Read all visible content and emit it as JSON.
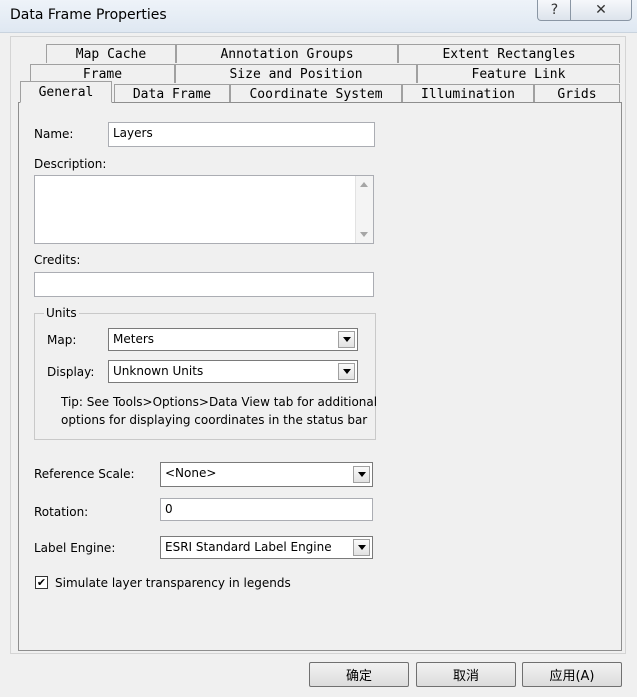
{
  "window": {
    "title": "Data Frame Properties",
    "help_glyph": "?",
    "close_glyph": "✕"
  },
  "tabs": {
    "row1": [
      "Map Cache",
      "Annotation Groups",
      "Extent Rectangles"
    ],
    "row2": [
      "Frame",
      "Size and Position",
      "Feature Link"
    ],
    "row3": [
      "General",
      "Data Frame",
      "Coordinate System",
      "Illumination",
      "Grids"
    ],
    "active": "General"
  },
  "general": {
    "name_label": "Name:",
    "name_value": "Layers",
    "description_label": "Description:",
    "description_value": "",
    "credits_label": "Credits:",
    "credits_value": "",
    "units": {
      "group_label": "Units",
      "map_label": "Map:",
      "map_value": "Meters",
      "display_label": "Display:",
      "display_value": "Unknown Units",
      "tip_line1": "Tip: See Tools>Options>Data View tab for additional",
      "tip_line2": "options for displaying coordinates in the status bar"
    },
    "reference_scale_label": "Reference Scale:",
    "reference_scale_value": "<None>",
    "rotation_label": "Rotation:",
    "rotation_value": "0",
    "label_engine_label": "Label Engine:",
    "label_engine_value": "ESRI Standard Label Engine",
    "simulate_label": "Simulate layer transparency in legends",
    "simulate_checked": "✔"
  },
  "buttons": {
    "ok": "确定",
    "cancel": "取消",
    "apply": "应用(A)"
  }
}
